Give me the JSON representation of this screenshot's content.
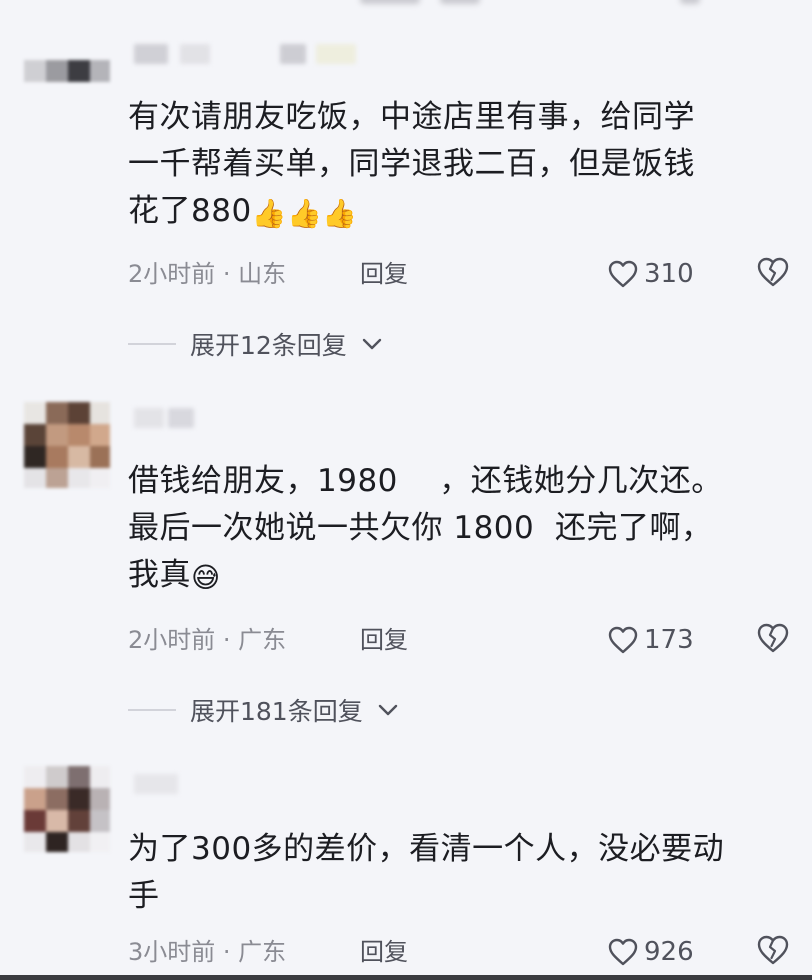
{
  "comments": [
    {
      "text_lines": [
        "有次请朋友吃饭，中途店里有事，给同学",
        "一千帮着买单，同学退我二百，但是饭钱",
        "花了880"
      ],
      "emoji": "👍👍👍",
      "time_location": "2小时前 · 山东",
      "reply_label": "回复",
      "like_count": "310",
      "expand_label": "展开12条回复"
    },
    {
      "text_lines": [
        "借钱给朋友，1980    ，还钱她分几次还。",
        "最后一次她说一共欠你 1800  还完了啊，",
        "我真"
      ],
      "emoji": "😅",
      "time_location": "2小时前 · 广东",
      "reply_label": "回复",
      "like_count": "173",
      "expand_label": "展开181条回复"
    },
    {
      "text_lines": [
        "为了300多的差价，看清一个人，没必要动",
        "手"
      ],
      "emoji": "",
      "time_location": "3小时前 · 广东",
      "reply_label": "回复",
      "like_count": "926",
      "expand_label": ""
    }
  ],
  "icons": {
    "like": "heart-outline-icon",
    "dislike": "broken-heart-outline-icon",
    "expand": "chevron-down-icon"
  },
  "colors": {
    "background": "#f4f5f9",
    "text": "#1c1d22",
    "meta": "#8a8b93",
    "action": "#50525c"
  }
}
